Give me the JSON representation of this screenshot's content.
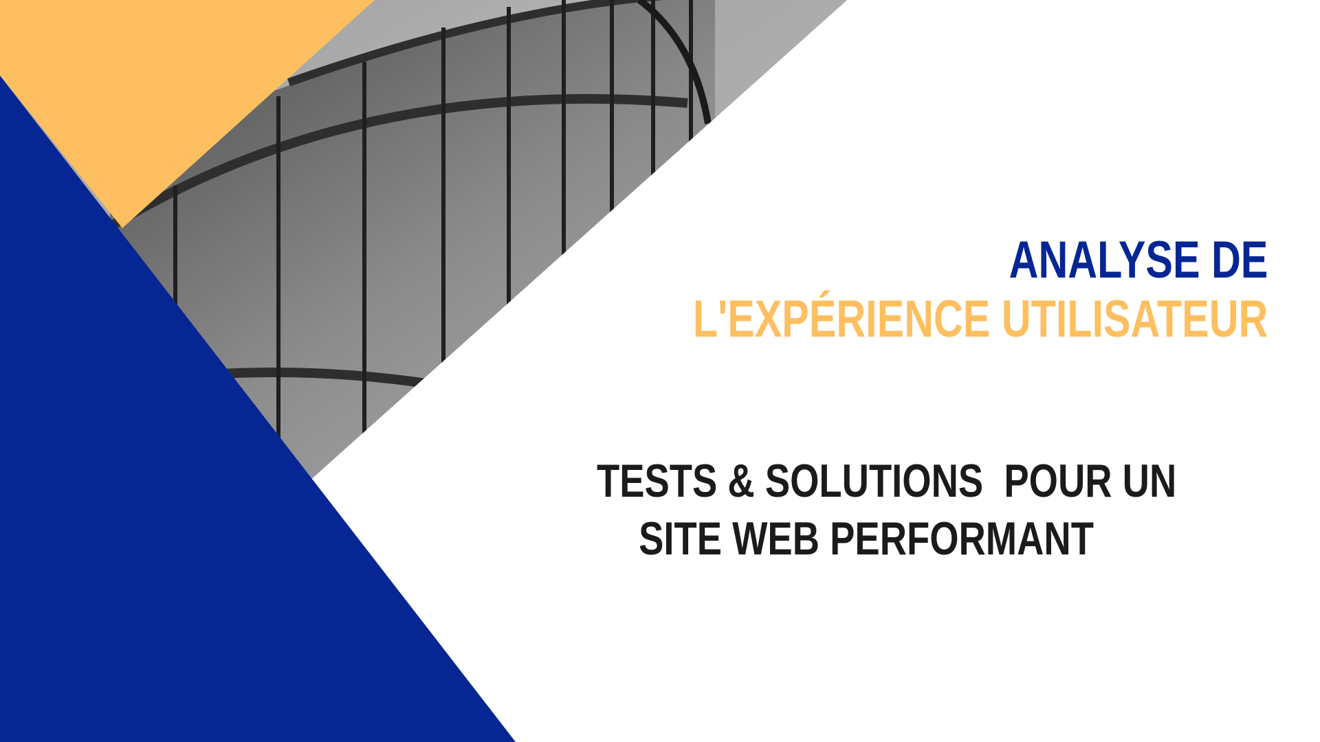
{
  "colors": {
    "blue": "#062694",
    "yellow": "#fdbf60",
    "text_dark": "#1b1b1b",
    "background": "#ffffff"
  },
  "heading": {
    "line1": "ANALYSE DE",
    "line2": "L'EXPÉRIENCE UTILISATEUR"
  },
  "subheading": {
    "line1": "TESTS & SOLUTIONS  POUR UN",
    "line2": "SITE WEB PERFORMANT"
  },
  "image": {
    "subject": "black-and-white photo of a curved glass office building facade"
  }
}
